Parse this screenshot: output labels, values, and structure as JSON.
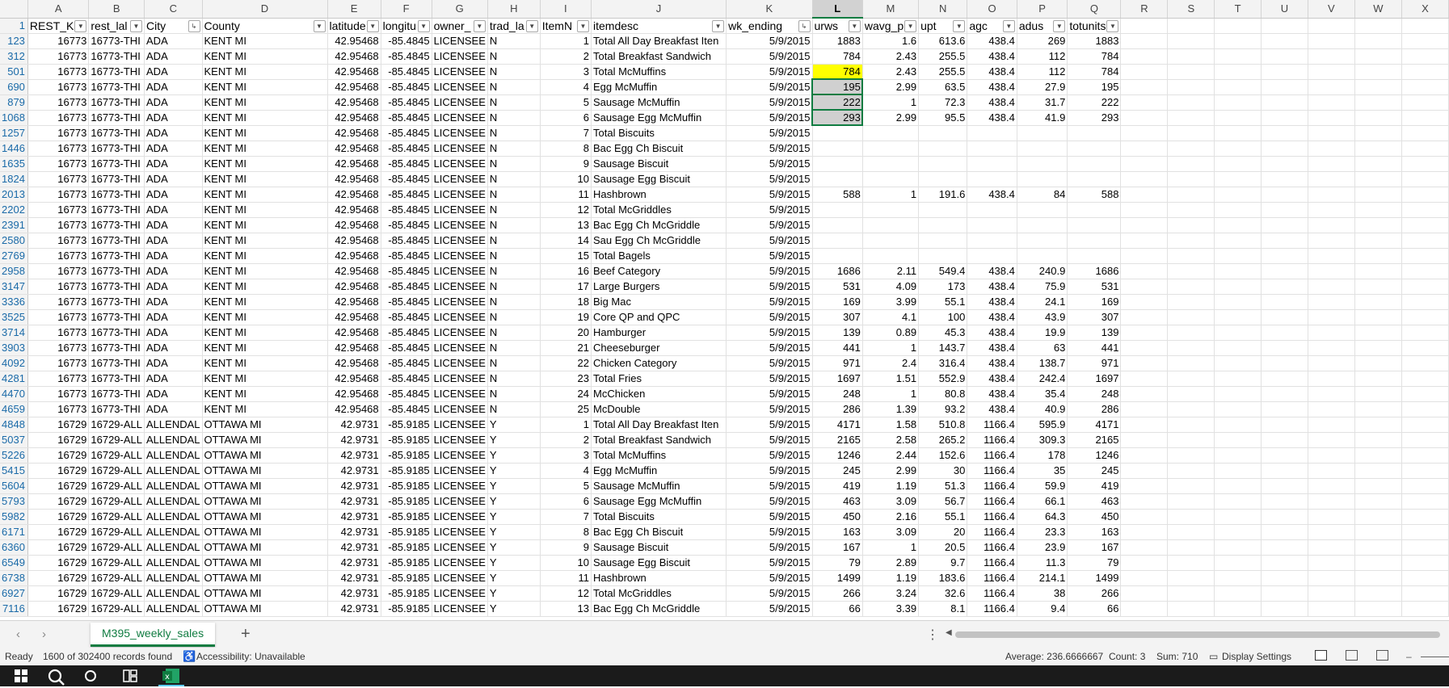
{
  "columns": [
    "A",
    "B",
    "C",
    "D",
    "E",
    "F",
    "G",
    "H",
    "I",
    "J",
    "K",
    "L",
    "M",
    "N",
    "O",
    "P",
    "Q",
    "R",
    "S",
    "T",
    "U",
    "V",
    "W",
    "X"
  ],
  "header_row_num": "1",
  "headers": [
    "REST_K",
    "rest_lal",
    "City",
    "County",
    "latitude",
    "longitu",
    "owner_",
    "trad_la",
    "ItemN",
    "itemdesc",
    "wk_ending",
    "urws",
    "wavg_p",
    "upt",
    "agc",
    "adus",
    "totunits"
  ],
  "rows": [
    {
      "n": "123",
      "c": [
        "16773",
        "16773-THI",
        "ADA",
        "KENT MI",
        "42.95468",
        "-85.4845",
        "LICENSEE",
        "N",
        "1",
        "Total All Day Breakfast Iten",
        "5/9/2015",
        "1883",
        "1.6",
        "613.6",
        "438.4",
        "269",
        "1883"
      ]
    },
    {
      "n": "312",
      "c": [
        "16773",
        "16773-THI",
        "ADA",
        "KENT MI",
        "42.95468",
        "-85.4845",
        "LICENSEE",
        "N",
        "2",
        "Total Breakfast Sandwich",
        "5/9/2015",
        "784",
        "2.43",
        "255.5",
        "438.4",
        "112",
        "784"
      ]
    },
    {
      "n": "501",
      "c": [
        "16773",
        "16773-THI",
        "ADA",
        "KENT MI",
        "42.95468",
        "-85.4845",
        "LICENSEE",
        "N",
        "3",
        "Total McMuffins",
        "5/9/2015",
        "784",
        "2.43",
        "255.5",
        "438.4",
        "112",
        "784"
      ]
    },
    {
      "n": "690",
      "c": [
        "16773",
        "16773-THI",
        "ADA",
        "KENT MI",
        "42.95468",
        "-85.4845",
        "LICENSEE",
        "N",
        "4",
        "Egg McMuffin",
        "5/9/2015",
        "195",
        "2.99",
        "63.5",
        "438.4",
        "27.9",
        "195"
      ]
    },
    {
      "n": "879",
      "c": [
        "16773",
        "16773-THI",
        "ADA",
        "KENT MI",
        "42.95468",
        "-85.4845",
        "LICENSEE",
        "N",
        "5",
        "Sausage McMuffin",
        "5/9/2015",
        "222",
        "1",
        "72.3",
        "438.4",
        "31.7",
        "222"
      ]
    },
    {
      "n": "1068",
      "c": [
        "16773",
        "16773-THI",
        "ADA",
        "KENT MI",
        "42.95468",
        "-85.4845",
        "LICENSEE",
        "N",
        "6",
        "Sausage Egg McMuffin",
        "5/9/2015",
        "293",
        "2.99",
        "95.5",
        "438.4",
        "41.9",
        "293"
      ]
    },
    {
      "n": "1257",
      "c": [
        "16773",
        "16773-THI",
        "ADA",
        "KENT MI",
        "42.95468",
        "-85.4845",
        "LICENSEE",
        "N",
        "7",
        "Total Biscuits",
        "5/9/2015",
        "",
        "",
        "",
        "",
        "",
        ""
      ]
    },
    {
      "n": "1446",
      "c": [
        "16773",
        "16773-THI",
        "ADA",
        "KENT MI",
        "42.95468",
        "-85.4845",
        "LICENSEE",
        "N",
        "8",
        "Bac Egg Ch Biscuit",
        "5/9/2015",
        "",
        "",
        "",
        "",
        "",
        ""
      ]
    },
    {
      "n": "1635",
      "c": [
        "16773",
        "16773-THI",
        "ADA",
        "KENT MI",
        "42.95468",
        "-85.4845",
        "LICENSEE",
        "N",
        "9",
        "Sausage Biscuit",
        "5/9/2015",
        "",
        "",
        "",
        "",
        "",
        ""
      ]
    },
    {
      "n": "1824",
      "c": [
        "16773",
        "16773-THI",
        "ADA",
        "KENT MI",
        "42.95468",
        "-85.4845",
        "LICENSEE",
        "N",
        "10",
        "Sausage Egg Biscuit",
        "5/9/2015",
        "",
        "",
        "",
        "",
        "",
        ""
      ]
    },
    {
      "n": "2013",
      "c": [
        "16773",
        "16773-THI",
        "ADA",
        "KENT MI",
        "42.95468",
        "-85.4845",
        "LICENSEE",
        "N",
        "11",
        "Hashbrown",
        "5/9/2015",
        "588",
        "1",
        "191.6",
        "438.4",
        "84",
        "588"
      ]
    },
    {
      "n": "2202",
      "c": [
        "16773",
        "16773-THI",
        "ADA",
        "KENT MI",
        "42.95468",
        "-85.4845",
        "LICENSEE",
        "N",
        "12",
        "Total McGriddles",
        "5/9/2015",
        "",
        "",
        "",
        "",
        "",
        ""
      ]
    },
    {
      "n": "2391",
      "c": [
        "16773",
        "16773-THI",
        "ADA",
        "KENT MI",
        "42.95468",
        "-85.4845",
        "LICENSEE",
        "N",
        "13",
        "Bac Egg Ch McGriddle",
        "5/9/2015",
        "",
        "",
        "",
        "",
        "",
        ""
      ]
    },
    {
      "n": "2580",
      "c": [
        "16773",
        "16773-THI",
        "ADA",
        "KENT MI",
        "42.95468",
        "-85.4845",
        "LICENSEE",
        "N",
        "14",
        "Sau Egg Ch McGriddle",
        "5/9/2015",
        "",
        "",
        "",
        "",
        "",
        ""
      ]
    },
    {
      "n": "2769",
      "c": [
        "16773",
        "16773-THI",
        "ADA",
        "KENT MI",
        "42.95468",
        "-85.4845",
        "LICENSEE",
        "N",
        "15",
        "Total Bagels",
        "5/9/2015",
        "",
        "",
        "",
        "",
        "",
        ""
      ]
    },
    {
      "n": "2958",
      "c": [
        "16773",
        "16773-THI",
        "ADA",
        "KENT MI",
        "42.95468",
        "-85.4845",
        "LICENSEE",
        "N",
        "16",
        "Beef Category",
        "5/9/2015",
        "1686",
        "2.11",
        "549.4",
        "438.4",
        "240.9",
        "1686"
      ]
    },
    {
      "n": "3147",
      "c": [
        "16773",
        "16773-THI",
        "ADA",
        "KENT MI",
        "42.95468",
        "-85.4845",
        "LICENSEE",
        "N",
        "17",
        "Large Burgers",
        "5/9/2015",
        "531",
        "4.09",
        "173",
        "438.4",
        "75.9",
        "531"
      ]
    },
    {
      "n": "3336",
      "c": [
        "16773",
        "16773-THI",
        "ADA",
        "KENT MI",
        "42.95468",
        "-85.4845",
        "LICENSEE",
        "N",
        "18",
        "Big Mac",
        "5/9/2015",
        "169",
        "3.99",
        "55.1",
        "438.4",
        "24.1",
        "169"
      ]
    },
    {
      "n": "3525",
      "c": [
        "16773",
        "16773-THI",
        "ADA",
        "KENT MI",
        "42.95468",
        "-85.4845",
        "LICENSEE",
        "N",
        "19",
        "Core QP and QPC",
        "5/9/2015",
        "307",
        "4.1",
        "100",
        "438.4",
        "43.9",
        "307"
      ]
    },
    {
      "n": "3714",
      "c": [
        "16773",
        "16773-THI",
        "ADA",
        "KENT MI",
        "42.95468",
        "-85.4845",
        "LICENSEE",
        "N",
        "20",
        "Hamburger",
        "5/9/2015",
        "139",
        "0.89",
        "45.3",
        "438.4",
        "19.9",
        "139"
      ]
    },
    {
      "n": "3903",
      "c": [
        "16773",
        "16773-THI",
        "ADA",
        "KENT MI",
        "42.95468",
        "-85.4845",
        "LICENSEE",
        "N",
        "21",
        "Cheeseburger",
        "5/9/2015",
        "441",
        "1",
        "143.7",
        "438.4",
        "63",
        "441"
      ]
    },
    {
      "n": "4092",
      "c": [
        "16773",
        "16773-THI",
        "ADA",
        "KENT MI",
        "42.95468",
        "-85.4845",
        "LICENSEE",
        "N",
        "22",
        "Chicken Category",
        "5/9/2015",
        "971",
        "2.4",
        "316.4",
        "438.4",
        "138.7",
        "971"
      ]
    },
    {
      "n": "4281",
      "c": [
        "16773",
        "16773-THI",
        "ADA",
        "KENT MI",
        "42.95468",
        "-85.4845",
        "LICENSEE",
        "N",
        "23",
        "Total Fries",
        "5/9/2015",
        "1697",
        "1.51",
        "552.9",
        "438.4",
        "242.4",
        "1697"
      ]
    },
    {
      "n": "4470",
      "c": [
        "16773",
        "16773-THI",
        "ADA",
        "KENT MI",
        "42.95468",
        "-85.4845",
        "LICENSEE",
        "N",
        "24",
        "McChicken",
        "5/9/2015",
        "248",
        "1",
        "80.8",
        "438.4",
        "35.4",
        "248"
      ]
    },
    {
      "n": "4659",
      "c": [
        "16773",
        "16773-THI",
        "ADA",
        "KENT MI",
        "42.95468",
        "-85.4845",
        "LICENSEE",
        "N",
        "25",
        "McDouble",
        "5/9/2015",
        "286",
        "1.39",
        "93.2",
        "438.4",
        "40.9",
        "286"
      ]
    },
    {
      "n": "4848",
      "c": [
        "16729",
        "16729-ALL",
        "ALLENDAL",
        "OTTAWA MI",
        "42.9731",
        "-85.9185",
        "LICENSEE",
        "Y",
        "1",
        "Total All Day Breakfast Iten",
        "5/9/2015",
        "4171",
        "1.58",
        "510.8",
        "1166.4",
        "595.9",
        "4171"
      ]
    },
    {
      "n": "5037",
      "c": [
        "16729",
        "16729-ALL",
        "ALLENDAL",
        "OTTAWA MI",
        "42.9731",
        "-85.9185",
        "LICENSEE",
        "Y",
        "2",
        "Total Breakfast Sandwich",
        "5/9/2015",
        "2165",
        "2.58",
        "265.2",
        "1166.4",
        "309.3",
        "2165"
      ]
    },
    {
      "n": "5226",
      "c": [
        "16729",
        "16729-ALL",
        "ALLENDAL",
        "OTTAWA MI",
        "42.9731",
        "-85.9185",
        "LICENSEE",
        "Y",
        "3",
        "Total McMuffins",
        "5/9/2015",
        "1246",
        "2.44",
        "152.6",
        "1166.4",
        "178",
        "1246"
      ]
    },
    {
      "n": "5415",
      "c": [
        "16729",
        "16729-ALL",
        "ALLENDAL",
        "OTTAWA MI",
        "42.9731",
        "-85.9185",
        "LICENSEE",
        "Y",
        "4",
        "Egg McMuffin",
        "5/9/2015",
        "245",
        "2.99",
        "30",
        "1166.4",
        "35",
        "245"
      ]
    },
    {
      "n": "5604",
      "c": [
        "16729",
        "16729-ALL",
        "ALLENDAL",
        "OTTAWA MI",
        "42.9731",
        "-85.9185",
        "LICENSEE",
        "Y",
        "5",
        "Sausage McMuffin",
        "5/9/2015",
        "419",
        "1.19",
        "51.3",
        "1166.4",
        "59.9",
        "419"
      ]
    },
    {
      "n": "5793",
      "c": [
        "16729",
        "16729-ALL",
        "ALLENDAL",
        "OTTAWA MI",
        "42.9731",
        "-85.9185",
        "LICENSEE",
        "Y",
        "6",
        "Sausage Egg McMuffin",
        "5/9/2015",
        "463",
        "3.09",
        "56.7",
        "1166.4",
        "66.1",
        "463"
      ]
    },
    {
      "n": "5982",
      "c": [
        "16729",
        "16729-ALL",
        "ALLENDAL",
        "OTTAWA MI",
        "42.9731",
        "-85.9185",
        "LICENSEE",
        "Y",
        "7",
        "Total Biscuits",
        "5/9/2015",
        "450",
        "2.16",
        "55.1",
        "1166.4",
        "64.3",
        "450"
      ]
    },
    {
      "n": "6171",
      "c": [
        "16729",
        "16729-ALL",
        "ALLENDAL",
        "OTTAWA MI",
        "42.9731",
        "-85.9185",
        "LICENSEE",
        "Y",
        "8",
        "Bac Egg Ch Biscuit",
        "5/9/2015",
        "163",
        "3.09",
        "20",
        "1166.4",
        "23.3",
        "163"
      ]
    },
    {
      "n": "6360",
      "c": [
        "16729",
        "16729-ALL",
        "ALLENDAL",
        "OTTAWA MI",
        "42.9731",
        "-85.9185",
        "LICENSEE",
        "Y",
        "9",
        "Sausage Biscuit",
        "5/9/2015",
        "167",
        "1",
        "20.5",
        "1166.4",
        "23.9",
        "167"
      ]
    },
    {
      "n": "6549",
      "c": [
        "16729",
        "16729-ALL",
        "ALLENDAL",
        "OTTAWA MI",
        "42.9731",
        "-85.9185",
        "LICENSEE",
        "Y",
        "10",
        "Sausage Egg Biscuit",
        "5/9/2015",
        "79",
        "2.89",
        "9.7",
        "1166.4",
        "11.3",
        "79"
      ]
    },
    {
      "n": "6738",
      "c": [
        "16729",
        "16729-ALL",
        "ALLENDAL",
        "OTTAWA MI",
        "42.9731",
        "-85.9185",
        "LICENSEE",
        "Y",
        "11",
        "Hashbrown",
        "5/9/2015",
        "1499",
        "1.19",
        "183.6",
        "1166.4",
        "214.1",
        "1499"
      ]
    },
    {
      "n": "6927",
      "c": [
        "16729",
        "16729-ALL",
        "ALLENDAL",
        "OTTAWA MI",
        "42.9731",
        "-85.9185",
        "LICENSEE",
        "Y",
        "12",
        "Total McGriddles",
        "5/9/2015",
        "266",
        "3.24",
        "32.6",
        "1166.4",
        "38",
        "266"
      ]
    },
    {
      "n": "7116",
      "c": [
        "16729",
        "16729-ALL",
        "ALLENDAL",
        "OTTAWA MI",
        "42.9731",
        "-85.9185",
        "LICENSEE",
        "Y",
        "13",
        "Bac Egg Ch McGriddle",
        "5/9/2015",
        "66",
        "3.39",
        "8.1",
        "1166.4",
        "9.4",
        "66"
      ]
    }
  ],
  "sheet_tab": "M395_weekly_sales",
  "status": {
    "ready": "Ready",
    "records": "1600 of 302400 records found",
    "accessibility": "Accessibility: Unavailable",
    "average": "Average: 236.6666667",
    "count": "Count: 3",
    "sum": "Sum: 710",
    "display_settings": "Display Settings"
  },
  "colors": {
    "accent": "#107c41",
    "highlight": "#ffff00",
    "selection": "#d0d0d0"
  },
  "icons": [
    "filter-dropdown-icon",
    "sort-filter-icon",
    "add-sheet-icon",
    "accessibility-icon",
    "display-settings-icon",
    "normal-view-icon",
    "page-layout-icon",
    "page-break-icon",
    "windows-start-icon",
    "search-icon",
    "task-view-icon",
    "excel-icon"
  ]
}
